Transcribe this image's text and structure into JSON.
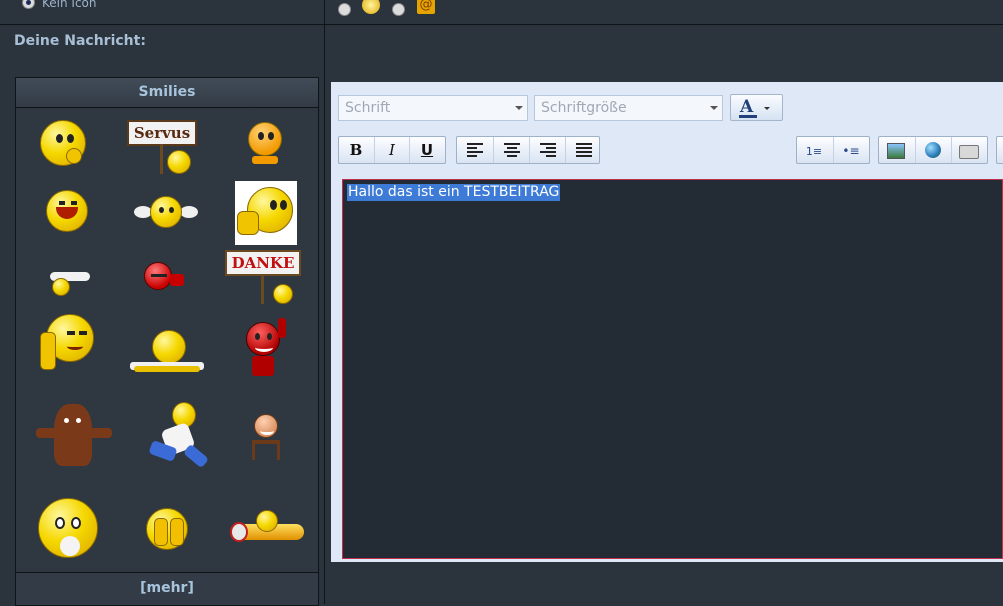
{
  "icon_row": {
    "label": "Kein Icon"
  },
  "message": {
    "label": "Deine Nachricht:"
  },
  "smilies": {
    "header": "Smilies",
    "more": "[mehr]",
    "sign_servus": "Servus",
    "sign_danke": "DANKE"
  },
  "editor": {
    "font_placeholder": "Schrift",
    "size_placeholder": "Schriftgröße",
    "color_letter": "A",
    "bold": "B",
    "italic": "I",
    "underline": "U",
    "content": "Hallo das ist ein TESTBEITRAG"
  },
  "colors": {
    "background": "#2b333c",
    "editor_bg": "#dfe8f6",
    "textarea_bg": "#232b34",
    "selection": "#3d7bd6",
    "textarea_border": "#c0304a"
  }
}
